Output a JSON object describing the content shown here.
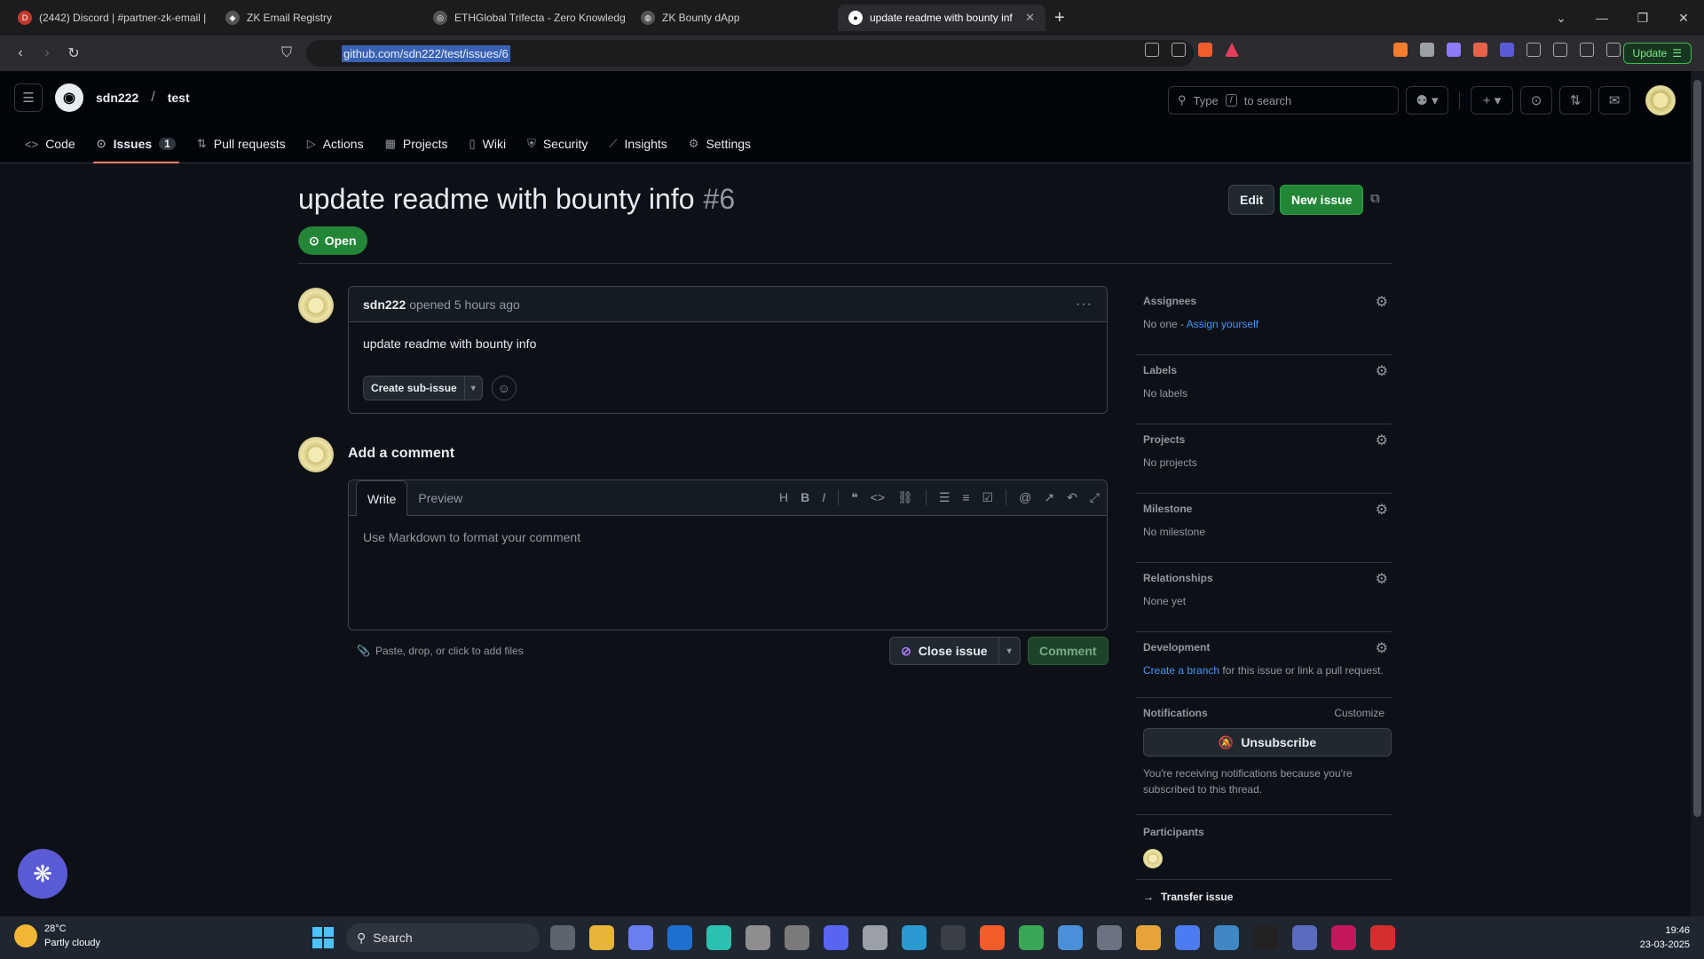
{
  "browser": {
    "tabs": [
      {
        "title": "(2442) Discord | #partner-zk-email |",
        "icon": "discord-icon",
        "color": "#c0392b"
      },
      {
        "title": "ZK Email Registry",
        "icon": "zk-icon",
        "color": "#888888"
      },
      {
        "title": "ETHGlobal Trifecta - Zero Knowledg",
        "icon": "ethglobal-icon",
        "color": "#888888"
      },
      {
        "title": "ZK Bounty dApp",
        "icon": "globe-icon",
        "color": "#888888"
      },
      {
        "title": "update readme with bounty inf",
        "icon": "github-icon",
        "color": "#ffffff"
      }
    ],
    "url": "github.com/sdn222/test/issues/6",
    "update_label": "Update"
  },
  "repo": {
    "owner": "sdn222",
    "name": "test",
    "search_prefix": "Type",
    "search_key": "/",
    "search_suffix": "to search",
    "nav": [
      {
        "label": "Code",
        "icon": "code-icon"
      },
      {
        "label": "Issues",
        "icon": "issue-opened-icon",
        "counter": "1"
      },
      {
        "label": "Pull requests",
        "icon": "git-pull-request-icon"
      },
      {
        "label": "Actions",
        "icon": "play-icon"
      },
      {
        "label": "Projects",
        "icon": "table-icon"
      },
      {
        "label": "Wiki",
        "icon": "book-icon"
      },
      {
        "label": "Security",
        "icon": "shield-icon"
      },
      {
        "label": "Insights",
        "icon": "graph-icon"
      },
      {
        "label": "Settings",
        "icon": "gear-icon"
      }
    ]
  },
  "issue": {
    "title": "update readme with bounty info",
    "number": "#6",
    "state": "Open",
    "edit_label": "Edit",
    "new_issue_label": "New issue",
    "author": "sdn222",
    "opened_text": "opened 5 hours ago",
    "body": "update readme with bounty info",
    "create_sub_issue_label": "Create sub-issue"
  },
  "comment_form": {
    "heading": "Add a comment",
    "tab_write": "Write",
    "tab_preview": "Preview",
    "placeholder": "Use Markdown to format your comment",
    "paste_hint": "Paste, drop, or click to add files",
    "close_issue_label": "Close issue",
    "comment_label": "Comment"
  },
  "sidebar": {
    "assignees": {
      "title": "Assignees",
      "value": "No one -",
      "link": "Assign yourself"
    },
    "labels": {
      "title": "Labels",
      "value": "No labels"
    },
    "projects": {
      "title": "Projects",
      "value": "No projects"
    },
    "milestone": {
      "title": "Milestone",
      "value": "No milestone"
    },
    "relationships": {
      "title": "Relationships",
      "value": "None yet"
    },
    "development": {
      "title": "Development",
      "link": "Create a branch",
      "value": "for this issue or link a pull request."
    },
    "notifications": {
      "title": "Notifications",
      "customize": "Customize",
      "unsubscribe": "Unsubscribe",
      "note": "You're receiving notifications because you're subscribed to this thread."
    },
    "participants": {
      "title": "Participants"
    },
    "transfer": "Transfer issue"
  },
  "taskbar": {
    "temp": "28°C",
    "weather": "Partly cloudy",
    "search": "Search",
    "time": "19:46",
    "date": "23-03-2025"
  }
}
